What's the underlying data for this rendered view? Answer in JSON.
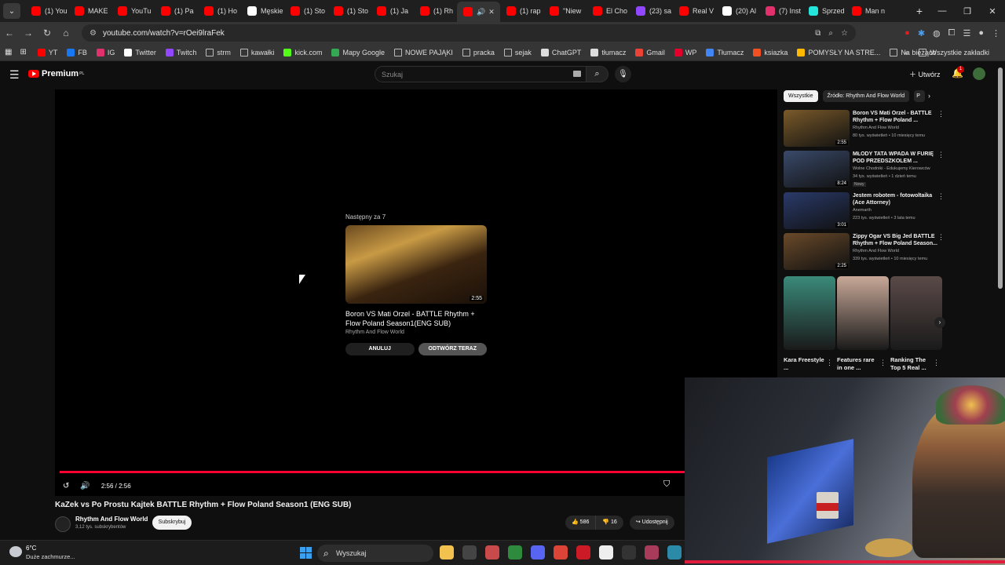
{
  "browser": {
    "tabs": [
      {
        "label": "(1) You",
        "color": "#ff0000"
      },
      {
        "label": "MAKE",
        "color": "#ff0000"
      },
      {
        "label": "YouTu",
        "color": "#ff0000"
      },
      {
        "label": "(1) Pa",
        "color": "#ff0000"
      },
      {
        "label": "(1) Ho",
        "color": "#ff0000"
      },
      {
        "label": "Męskie",
        "color": "#ffffff"
      },
      {
        "label": "(1) Sto",
        "color": "#ff0000"
      },
      {
        "label": "(1) Sto",
        "color": "#ff0000"
      },
      {
        "label": "(1) Ja",
        "color": "#ff0000"
      },
      {
        "label": "(1) Rh",
        "color": "#ff0000"
      },
      {
        "label": "",
        "color": "#ff0000",
        "active": true
      },
      {
        "label": "(1) rap",
        "color": "#ff0000"
      },
      {
        "label": "\"Niew",
        "color": "#ff0000"
      },
      {
        "label": "El Cho",
        "color": "#ff0000"
      },
      {
        "label": "(23) sa",
        "color": "#9146ff"
      },
      {
        "label": "Real V",
        "color": "#ff0000"
      },
      {
        "label": "(20) Al",
        "color": "#ffffff"
      },
      {
        "label": "(7) Inst",
        "color": "#e1306c"
      },
      {
        "label": "Sprzed",
        "color": "#23e5db"
      },
      {
        "label": "Man n",
        "color": "#ff0000"
      }
    ],
    "new_tab": "+",
    "active_tab_close": "✕",
    "url": "youtube.com/watch?v=rOei9lraFek",
    "bookmarks": [
      {
        "label": "YT",
        "color": "#ff0000"
      },
      {
        "label": "FB",
        "color": "#1877f2"
      },
      {
        "label": "IG",
        "color": "#e1306c"
      },
      {
        "label": "Twitter",
        "color": "#ffffff"
      },
      {
        "label": "Twitch",
        "color": "#9146ff"
      },
      {
        "label": "strm",
        "folder": true
      },
      {
        "label": "kawałki",
        "folder": true
      },
      {
        "label": "kick.com",
        "color": "#53fc18"
      },
      {
        "label": "Mapy Google",
        "color": "#34a853"
      },
      {
        "label": "NOWE PAJĄKI",
        "folder": true
      },
      {
        "label": "pracka",
        "folder": true
      },
      {
        "label": "sejak",
        "folder": true
      },
      {
        "label": "ChatGPT",
        "color": "#dddddd"
      },
      {
        "label": "tłumacz",
        "color": "#dddddd"
      },
      {
        "label": "Gmail",
        "color": "#ea4335"
      },
      {
        "label": "WP",
        "color": "#e4002b"
      },
      {
        "label": "Tłumacz",
        "color": "#4285f4"
      },
      {
        "label": "ksiazka",
        "color": "#f25022"
      },
      {
        "label": "POMYSŁY NA STRE...",
        "color": "#ffb900"
      },
      {
        "label": "Na bieżąco",
        "folder": true
      }
    ],
    "bookmarks_more": "»",
    "all_bookmarks": "Wszystkie zakładki"
  },
  "youtube": {
    "logo_text": "Premium",
    "logo_region": "PL",
    "search_placeholder": "Szukaj",
    "create_label": "Utwórz",
    "notification_count": "1"
  },
  "player": {
    "next_label": "Następny za 7",
    "next_video": {
      "duration": "2:55",
      "title": "Boron VS Mati Orzel - BATTLE Rhythm + Flow Poland Season1(ENG SUB)",
      "channel": "Rhythm And Flow World"
    },
    "cancel_label": "ANULUJ",
    "play_now_label": "ODTWÓRZ TERAZ",
    "time": "2:56 / 2:56",
    "progress": 1.0
  },
  "video": {
    "title": "KaZek vs Po Prostu Kajtek BATTLE Rhythm + Flow Poland Season1 (ENG SUB)",
    "channel": "Rhythm And Flow World",
    "subscribers": "3,12 tys. subskrybentów",
    "subscribe_label": "Subskrybuj",
    "likes": "586",
    "dislikes": "16",
    "share_label": "Udostępnij"
  },
  "sidebar": {
    "chips": [
      "Wszystkie",
      "Źródło: Rhythm And Flow World",
      "P"
    ],
    "recommendations": [
      {
        "title": "Boron VS Mati Orzel - BATTLE Rhythm + Flow Poland ...",
        "channel": "Rhythm And Flow World",
        "meta": "80 tys. wyświetleń • 10 miesięcy temu",
        "duration": "2:55",
        "color": "#7a5a2a"
      },
      {
        "title": "MŁODY TATA WPADA W FURIĘ POD PRZEDSZKOLEM ...",
        "channel": "Wolne Chodniki - Edukujemy Kierowców",
        "meta": "34 tys. wyświetleń • 1 dzień temu",
        "badge": "Nowy",
        "duration": "8:24",
        "color": "#3a4a6a"
      },
      {
        "title": "Jestem robotem - fotowoltaika (Ace Attorney)",
        "channel": "Anemarth",
        "meta": "223 tys. wyświetleń • 3 lata temu",
        "duration": "3:01",
        "color": "#2a3a6a"
      },
      {
        "title": "Zippy Ogar VS Big Jed BATTLE Rhythm + Flow Poland Season...",
        "channel": "Rhythm And Flow World",
        "meta": "339 tys. wyświetleń • 10 miesięcy temu",
        "duration": "2:25",
        "color": "#6a4a2a"
      }
    ],
    "shorts": [
      {
        "title": "Kara Freestyle ...",
        "color": "#3a8a7a"
      },
      {
        "title": "Features rare in one ...",
        "color": "#c8a898"
      },
      {
        "title": "Ranking The Top 5 Real ...",
        "color": "#5a4a48"
      }
    ]
  },
  "taskbar": {
    "temperature": "6°C",
    "weather": "Duże zachmurze...",
    "search_label": "Wyszukaj",
    "apps": [
      {
        "name": "file-explorer",
        "color": "#f2c14e"
      },
      {
        "name": "app-red-dot",
        "color": "#444444"
      },
      {
        "name": "photo-app",
        "color": "#c84a4a"
      },
      {
        "name": "shield-app",
        "color": "#2e8b3e"
      },
      {
        "name": "discord",
        "color": "#5865f2"
      },
      {
        "name": "chrome",
        "color": "#db4437"
      },
      {
        "name": "opera",
        "color": "#cc1b26"
      },
      {
        "name": "notes-app",
        "color": "#eeeeee"
      },
      {
        "name": "mouse-app",
        "color": "#333333"
      },
      {
        "name": "image-app",
        "color": "#a83a5a"
      },
      {
        "name": "globe-app",
        "color": "#2a8aa8"
      }
    ]
  }
}
